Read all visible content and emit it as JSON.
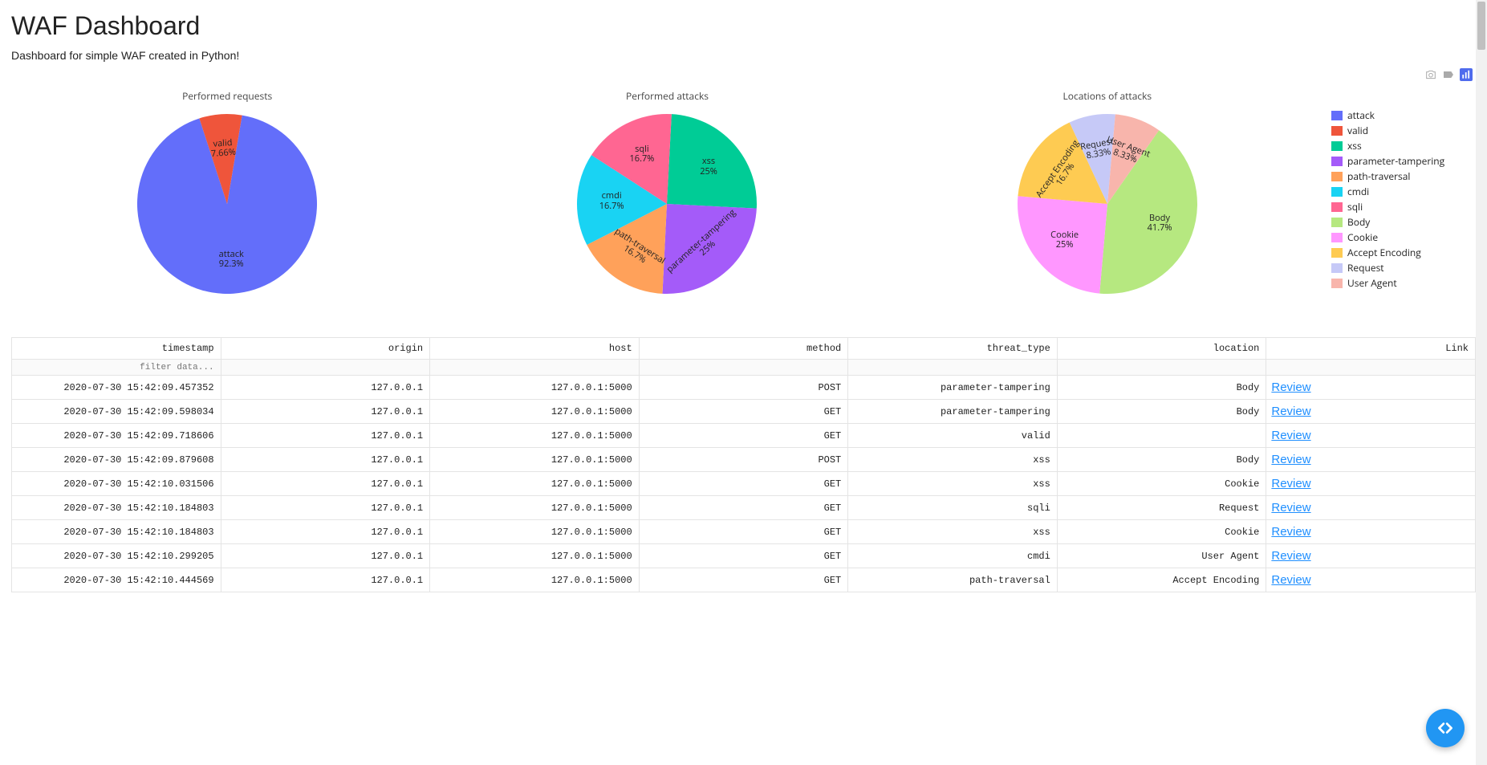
{
  "header": {
    "title": "WAF Dashboard",
    "subtitle": "Dashboard for simple WAF created in Python!"
  },
  "toolbar": {
    "camera_icon": "camera-icon",
    "tag_icon": "tag-icon",
    "chart_icon": "chart-icon"
  },
  "legend": [
    {
      "label": "attack",
      "color": "#636efa"
    },
    {
      "label": "valid",
      "color": "#ef553b"
    },
    {
      "label": "xss",
      "color": "#00cc96"
    },
    {
      "label": "parameter-tampering",
      "color": "#a45bf9"
    },
    {
      "label": "path-traversal",
      "color": "#ffa15a"
    },
    {
      "label": "cmdi",
      "color": "#19d3f3"
    },
    {
      "label": "sqli",
      "color": "#ff6692"
    },
    {
      "label": "Body",
      "color": "#b6e880"
    },
    {
      "label": "Cookie",
      "color": "#ff97ff"
    },
    {
      "label": "Accept Encoding",
      "color": "#fecb52"
    },
    {
      "label": "Request",
      "color": "#c6c9f7"
    },
    {
      "label": "User Agent",
      "color": "#f8b5ac"
    }
  ],
  "chart_data": [
    {
      "type": "pie",
      "title": "Performed requests",
      "series": [
        {
          "name": "attack",
          "value": 92.3,
          "color": "#636efa"
        },
        {
          "name": "valid",
          "value": 7.66,
          "color": "#ef553b"
        }
      ]
    },
    {
      "type": "pie",
      "title": "Performed attacks",
      "series": [
        {
          "name": "xss",
          "value": 25.0,
          "color": "#00cc96"
        },
        {
          "name": "parameter-tampering",
          "value": 25.0,
          "color": "#a45bf9"
        },
        {
          "name": "path-traversal",
          "value": 16.7,
          "color": "#ffa15a"
        },
        {
          "name": "cmdi",
          "value": 16.7,
          "color": "#19d3f3"
        },
        {
          "name": "sqli",
          "value": 16.7,
          "color": "#ff6692"
        }
      ]
    },
    {
      "type": "pie",
      "title": "Locations of attacks",
      "series": [
        {
          "name": "Body",
          "value": 41.7,
          "color": "#b6e880"
        },
        {
          "name": "Cookie",
          "value": 25.0,
          "color": "#ff97ff"
        },
        {
          "name": "Accept Encoding",
          "value": 16.7,
          "color": "#fecb52"
        },
        {
          "name": "Request",
          "value": 8.33,
          "color": "#c6c9f7"
        },
        {
          "name": "User Agent",
          "value": 8.33,
          "color": "#f8b5ac"
        }
      ]
    }
  ],
  "table": {
    "columns": [
      "timestamp",
      "origin",
      "host",
      "method",
      "threat_type",
      "location",
      "Link"
    ],
    "filter_placeholder": "filter data...",
    "link_label": "Review",
    "rows": [
      {
        "timestamp": "2020-07-30 15:42:09.457352",
        "origin": "127.0.0.1",
        "host": "127.0.0.1:5000",
        "method": "POST",
        "threat_type": "parameter-tampering",
        "location": "Body"
      },
      {
        "timestamp": "2020-07-30 15:42:09.598034",
        "origin": "127.0.0.1",
        "host": "127.0.0.1:5000",
        "method": "GET",
        "threat_type": "parameter-tampering",
        "location": "Body"
      },
      {
        "timestamp": "2020-07-30 15:42:09.718606",
        "origin": "127.0.0.1",
        "host": "127.0.0.1:5000",
        "method": "GET",
        "threat_type": "valid",
        "location": ""
      },
      {
        "timestamp": "2020-07-30 15:42:09.879608",
        "origin": "127.0.0.1",
        "host": "127.0.0.1:5000",
        "method": "POST",
        "threat_type": "xss",
        "location": "Body"
      },
      {
        "timestamp": "2020-07-30 15:42:10.031506",
        "origin": "127.0.0.1",
        "host": "127.0.0.1:5000",
        "method": "GET",
        "threat_type": "xss",
        "location": "Cookie"
      },
      {
        "timestamp": "2020-07-30 15:42:10.184803",
        "origin": "127.0.0.1",
        "host": "127.0.0.1:5000",
        "method": "GET",
        "threat_type": "sqli",
        "location": "Request"
      },
      {
        "timestamp": "2020-07-30 15:42:10.184803",
        "origin": "127.0.0.1",
        "host": "127.0.0.1:5000",
        "method": "GET",
        "threat_type": "xss",
        "location": "Cookie"
      },
      {
        "timestamp": "2020-07-30 15:42:10.299205",
        "origin": "127.0.0.1",
        "host": "127.0.0.1:5000",
        "method": "GET",
        "threat_type": "cmdi",
        "location": "User Agent"
      },
      {
        "timestamp": "2020-07-30 15:42:10.444569",
        "origin": "127.0.0.1",
        "host": "127.0.0.1:5000",
        "method": "GET",
        "threat_type": "path-traversal",
        "location": "Accept Encoding"
      }
    ]
  },
  "fab": {
    "label": "debug-toggle"
  }
}
